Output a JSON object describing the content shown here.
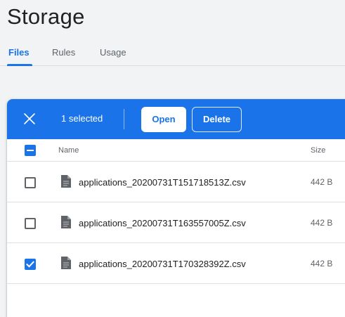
{
  "page": {
    "title": "Storage"
  },
  "tabs": [
    {
      "label": "Files",
      "active": true
    },
    {
      "label": "Rules",
      "active": false
    },
    {
      "label": "Usage",
      "active": false
    }
  ],
  "action_bar": {
    "selected_text": "1 selected",
    "open_label": "Open",
    "delete_label": "Delete",
    "color": "#1a73e8"
  },
  "table": {
    "columns": [
      "Name",
      "Size"
    ],
    "select_all_state": "indeterminate",
    "rows": [
      {
        "name": "applications_20200731T151718513Z.csv",
        "size": "442 B",
        "checked": false,
        "icon": "file-icon"
      },
      {
        "name": "applications_20200731T163557005Z.csv",
        "size": "442 B",
        "checked": false,
        "icon": "file-icon"
      },
      {
        "name": "applications_20200731T170328392Z.csv",
        "size": "442 B",
        "checked": true,
        "icon": "file-icon"
      }
    ]
  },
  "colors": {
    "accent": "#1a73e8",
    "background": "#f1f3f4"
  }
}
